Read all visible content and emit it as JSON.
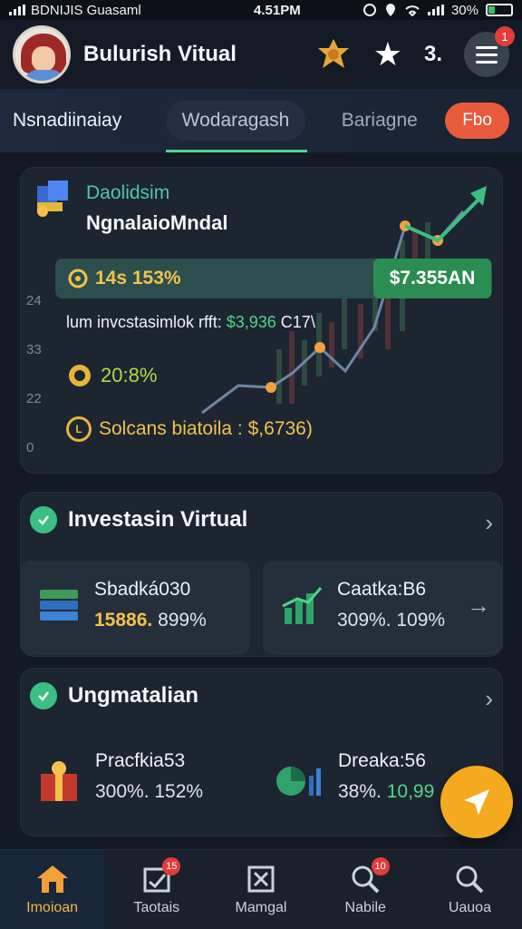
{
  "status_bar": {
    "carrier": "BDNIJIS Guasaml",
    "time": "4.51PM",
    "battery": "30%",
    "battery_level": 0.3
  },
  "header": {
    "title": "Bulurish Vitual",
    "level": "3.",
    "menu_badge": "1"
  },
  "tabs": [
    {
      "label": "Nsnadiinaiay"
    },
    {
      "label": "Wodaragash"
    },
    {
      "label": "Bariagne"
    }
  ],
  "tab_pill": "Fbo",
  "hero": {
    "subtitle": "Daolidsim",
    "title": "NgnalaioMndal",
    "band_text": "14s 153%",
    "value_chip": "$7.355AN",
    "y_ticks": [
      "24",
      "33",
      "22",
      "0"
    ],
    "line_text": "lum invcstasimlok rfft:",
    "line_amount": "$3,936",
    "line_suffix": "C17\\",
    "pct": "20:8%",
    "balance": "Solcans biatoila : $,6736)",
    "coin_glyph": "L"
  },
  "section_investasi": {
    "title": "Investasin Virtual",
    "cards": [
      {
        "label": "Sbadká030",
        "value_main": "15886.",
        "value_rest": " 899%"
      },
      {
        "label": "Caatka:B6",
        "value_main": "309%.",
        "value_rest": " 109%"
      }
    ]
  },
  "section_ungmatalian": {
    "title": "Ungmatalian",
    "cards": [
      {
        "label": "Pracfkia53",
        "value_main": "300%.",
        "value_rest": " 152%"
      },
      {
        "label": "Dreaka:56",
        "value_main": "38%.",
        "value_rest": " 10,99"
      }
    ]
  },
  "bottom_nav": [
    {
      "label": "Imoioan",
      "icon": "home-icon",
      "badge": ""
    },
    {
      "label": "Taotais",
      "icon": "chart-check-icon",
      "badge": "15"
    },
    {
      "label": "Mamgal",
      "icon": "close-box-icon",
      "badge": ""
    },
    {
      "label": "Nabile",
      "icon": "search-icon",
      "badge": "10"
    },
    {
      "label": "Uauoa",
      "icon": "search-icon",
      "badge": ""
    }
  ],
  "colors": {
    "background": "#141a24",
    "accent_green": "#4fd68b",
    "accent_yellow": "#f3c24b",
    "accent_orange": "#e85a3c",
    "fab": "#f4a91f"
  }
}
